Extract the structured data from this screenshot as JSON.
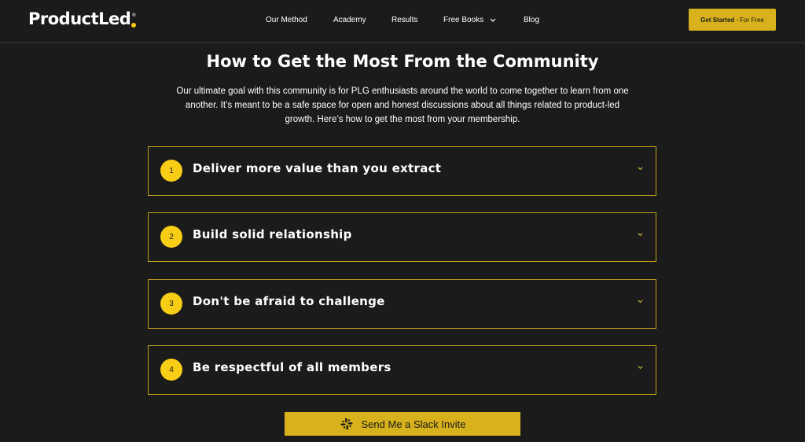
{
  "header": {
    "logo": "ProductLed",
    "logo_mark": "®",
    "nav": [
      {
        "label": "Our Method"
      },
      {
        "label": "Academy"
      },
      {
        "label": "Results"
      },
      {
        "label": "Free Books"
      },
      {
        "label": "Blog"
      }
    ],
    "cta_bold": "Get Started",
    "cta_rest": "- For Free"
  },
  "main": {
    "title": "How to Get the Most From the Community",
    "intro": "Our ultimate goal with this community is for PLG enthusiasts around the world to come together to learn from one another. It’s meant to be a safe space for open and honest discussions about all things related to product-led growth. Here’s how to get the most from your membership.",
    "items": [
      {
        "number": "1",
        "title": "Deliver more value than you extract"
      },
      {
        "number": "2",
        "title": "Build solid relationship"
      },
      {
        "number": "3",
        "title": "Don't be afraid to challenge"
      },
      {
        "number": "4",
        "title": "Be respectful of all members"
      }
    ],
    "slack_button": "Send Me a Slack Invite"
  },
  "colors": {
    "background": "#1c1b1b",
    "accent": "#d7b21c",
    "badge": "#f7cd16",
    "border": "#bf9f1d"
  },
  "icons": [
    "chevron-down-icon",
    "slack-icon"
  ]
}
